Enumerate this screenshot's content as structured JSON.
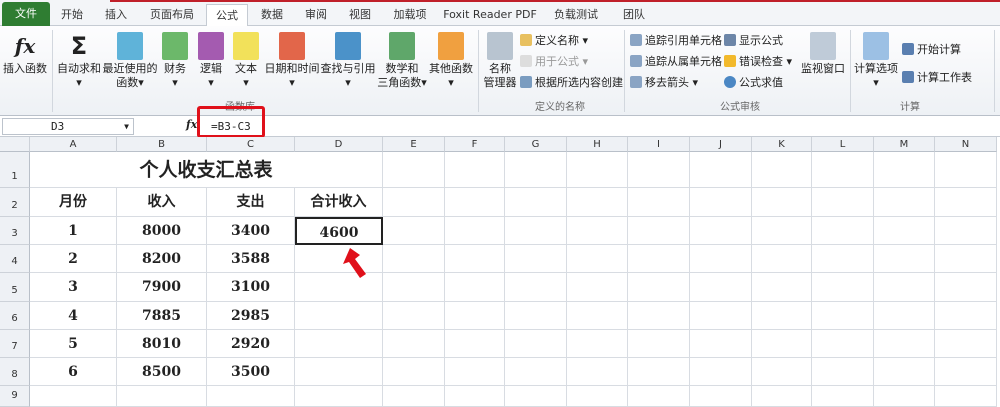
{
  "tabs": [
    "文件",
    "开始",
    "插入",
    "页面布局",
    "公式",
    "数据",
    "审阅",
    "视图",
    "加载项",
    "Foxit Reader PDF",
    "负载测试",
    "团队"
  ],
  "ribbon": {
    "function_library": {
      "label": "函数库",
      "buttons": [
        "插入函数",
        "自动求和",
        "最近使用的",
        "函数",
        "财务",
        "逻辑",
        "文本",
        "日期和时间",
        "查找与引用",
        "数学和",
        "三角函数",
        "其他函数"
      ]
    },
    "defined_names": {
      "label": "定义的名称",
      "name_manager": [
        "名称",
        "管理器"
      ],
      "items": [
        "定义名称",
        "用于公式",
        "根据所选内容创建"
      ]
    },
    "formula_auditing": {
      "label": "公式审核",
      "items": [
        "追踪引用单元格",
        "追踪从属单元格",
        "移去箭头",
        "显示公式",
        "错误检查",
        "公式求值"
      ],
      "watch": "监视窗口"
    },
    "calculation": {
      "label": "计算",
      "options": "计算选项",
      "items": [
        "开始计算",
        "计算工作表"
      ]
    }
  },
  "formula_bar": {
    "name_box": "D3",
    "fx": "fx",
    "formula": "=B3-C3"
  },
  "columns": [
    "A",
    "B",
    "C",
    "D",
    "E",
    "F",
    "G",
    "H",
    "I",
    "J",
    "K",
    "L",
    "M",
    "N"
  ],
  "rows": [
    "1",
    "2",
    "3",
    "4",
    "5",
    "6",
    "7",
    "8",
    "9"
  ],
  "sheet": {
    "title": "个人收支汇总表",
    "headers": [
      "月份",
      "收入",
      "支出",
      "合计收入"
    ],
    "data": [
      [
        "1",
        "8000",
        "3400",
        "4600"
      ],
      [
        "2",
        "8200",
        "3588",
        ""
      ],
      [
        "3",
        "7900",
        "3100",
        ""
      ],
      [
        "4",
        "7885",
        "2985",
        ""
      ],
      [
        "5",
        "8010",
        "2920",
        ""
      ],
      [
        "6",
        "8500",
        "3500",
        ""
      ]
    ]
  },
  "colors": {
    "file_tab": "#2f7d32",
    "highlight": "#e0101a"
  }
}
